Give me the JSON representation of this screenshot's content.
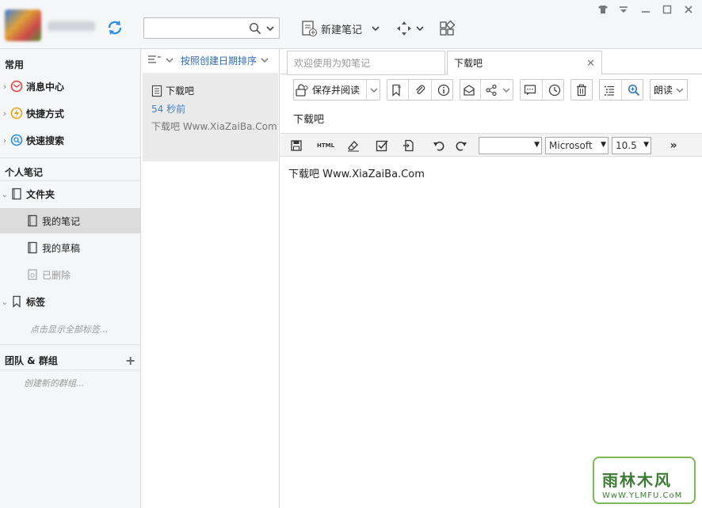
{
  "top": {
    "search_value": "",
    "new_note_label": "新建笔记"
  },
  "sidebar": {
    "common_header": "常用",
    "common_items": [
      {
        "label": "消息中心"
      },
      {
        "label": "快捷方式"
      },
      {
        "label": "快速搜索"
      }
    ],
    "personal_header": "个人笔记",
    "folder_label": "文件夹",
    "folder_items": [
      {
        "label": "我的笔记"
      },
      {
        "label": "我的草稿"
      },
      {
        "label": "已删除"
      }
    ],
    "tags_label": "标签",
    "tags_hint": "点击显示全部标签...",
    "team_header": "团队 & 群组",
    "team_hint": "创建新的群组..."
  },
  "note_list": {
    "sort_label": "按照创建日期排序",
    "notes": [
      {
        "title": "下载吧",
        "time": "54 秒前",
        "snippet": "下载吧 Www.XiaZaiBa.Com"
      }
    ]
  },
  "editor": {
    "tabs": [
      {
        "label": "欢迎使用为知笔记"
      },
      {
        "label": "下载吧"
      }
    ],
    "save_read_label": "保存并阅读",
    "read_aloud_label": "朗读",
    "note_title": "下载吧",
    "format": {
      "html_label": "HTML",
      "font_name": "Microsoft",
      "font_size": "10.5",
      "style_value": "",
      "more_label": "»"
    },
    "body": "下载吧 Www.XiaZaiBa.Com"
  },
  "watermark": {
    "title": "雨林木风",
    "url": "WwW.YLMFU.CoM"
  },
  "colors": {
    "accent_link": "#2d6bb5",
    "time_blue": "#4a7fc0",
    "sidebar_bg": "#f5f6f7",
    "selected_bg": "#dcdcdc"
  }
}
